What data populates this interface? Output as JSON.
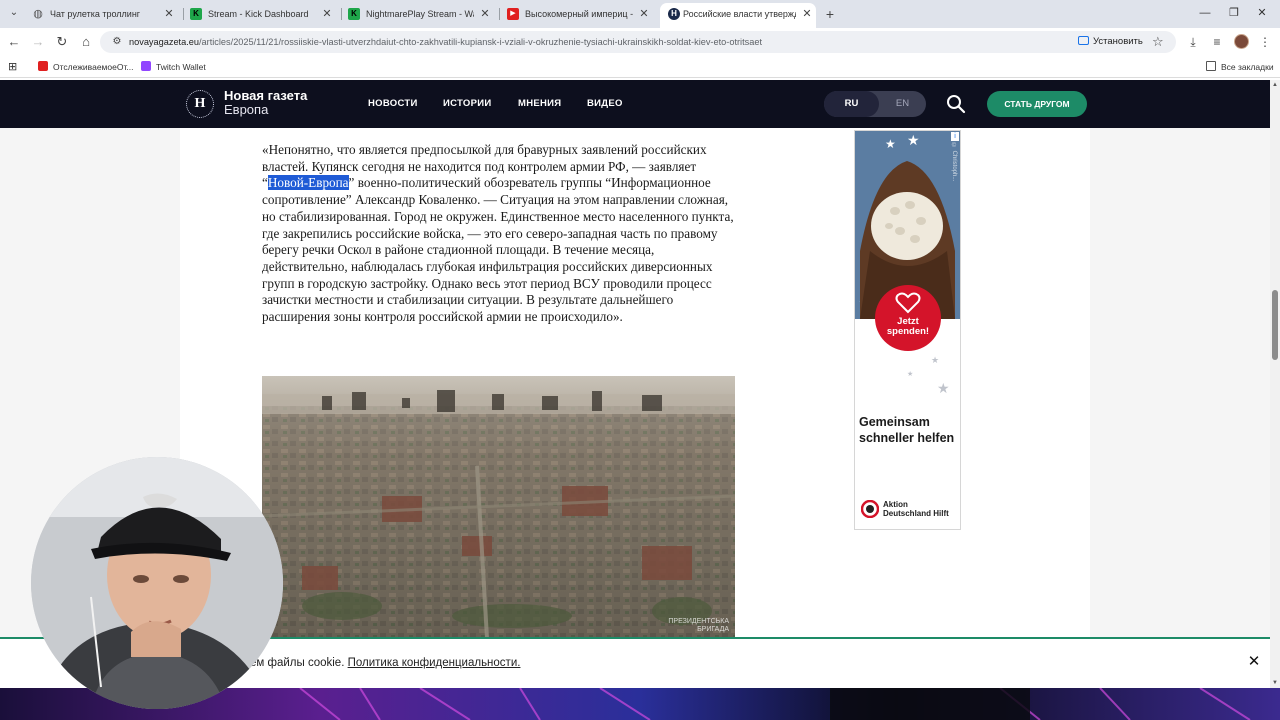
{
  "browser": {
    "tabs": [
      {
        "title": "Чат рулетка троллинг",
        "favicon": "globe-icon",
        "active": false
      },
      {
        "title": "Stream - Kick Dashboard",
        "favicon": "kick-icon",
        "active": false
      },
      {
        "title": "NightmarePlay Stream - Watch",
        "favicon": "kick-icon",
        "active": false
      },
      {
        "title": "Высокомерный империц - Сер",
        "favicon": "youtube-icon",
        "active": false
      },
      {
        "title": "Российские власти утвержда",
        "favicon": "novaya-gazeta-icon",
        "active": true
      }
    ],
    "url_host": "novayagazeta.eu",
    "url_path": "/articles/2025/11/21/rossiiskie-vlasti-utverzhdaiut-chto-zakhvatili-kupiansk-i-vziali-v-okruzhenie-tysiachi-ukrainskikh-soldat-kiev-eto-otritsaet",
    "install_label": "Установить",
    "bookmarks": [
      {
        "label": "ОтслеживаемоеОт...",
        "icon": "youtube-icon"
      },
      {
        "label": "Twitch Wallet",
        "icon": "twitch-icon"
      }
    ],
    "all_bookmarks_label": "Все закладки"
  },
  "site": {
    "logo_mark": "Н",
    "logo_title": "Новая газета",
    "logo_subtitle": "Европа",
    "nav": [
      "НОВОСТИ",
      "ИСТОРИИ",
      "МНЕНИЯ",
      "ВИДЕО"
    ],
    "lang_ru": "RU",
    "lang_en": "EN",
    "friend_button": "СТАТЬ ДРУГОМ",
    "accent_color": "#1d8b67",
    "header_color": "#0d0f1e"
  },
  "article": {
    "paragraph_before": "«Непонятно, что является предпосылкой для бравурных заявлений российских властей. Купянск сегодня не находится под контролем армии РФ, — заявляет “",
    "highlighted": "Новой-Европа",
    "paragraph_after": "” военно-политический обозреватель группы “Информационное сопротивление” Александр Коваленко. — Ситуация на этом направлении сложная, но стабилизированная. Город не окружен. Единственное место населенного пункта, где закрепились российские войска, — это его северо-западная часть по правому берегу речки Оскол в районе стадионной площади. В течение месяца, действительно, наблюдалась глубокая инфильтрация российских диверсионных групп в городскую застройку. Однако весь этот период ВСУ проводили процесс зачистки местности и стабилизации ситуации. В результате дальнейшего расширения зоны контроля российской армии не происходило».",
    "photo_credit": "ПРЕЗИДЕНТСЬКА\nБРИГАДА"
  },
  "ad": {
    "donate_label": "Jetzt spenden!",
    "title": "Gemeinsam schneller helfen",
    "brand_line1": "Aktion",
    "brand_line2": "Deutschland Hilft",
    "photo_credit": "© Christoph..."
  },
  "cookie": {
    "text": "ем файлы cookie. ",
    "link": "Политика конфиденциальности."
  }
}
